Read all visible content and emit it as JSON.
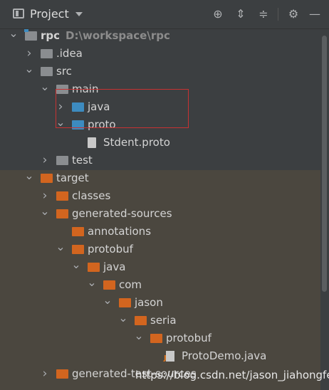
{
  "header": {
    "title": "Project",
    "icons": [
      "locate-icon",
      "expand-all-icon",
      "collapse-all-icon",
      "settings-icon",
      "hide-icon"
    ]
  },
  "tree": [
    {
      "label": "rpc",
      "path": "D:\\workspace\\rpc",
      "depth": 0,
      "arrow": "down",
      "icon": "folder-module",
      "bold": true
    },
    {
      "label": ".idea",
      "depth": 1,
      "arrow": "right",
      "icon": "folder-grey"
    },
    {
      "label": "src",
      "depth": 1,
      "arrow": "down",
      "icon": "folder-grey"
    },
    {
      "label": "main",
      "depth": 2,
      "arrow": "down",
      "icon": "folder-grey"
    },
    {
      "label": "java",
      "depth": 3,
      "arrow": "right",
      "icon": "folder-blue"
    },
    {
      "label": "proto",
      "depth": 3,
      "arrow": "down",
      "icon": "folder-blue"
    },
    {
      "label": "Stdent.proto",
      "depth": 4,
      "arrow": "none",
      "icon": "file"
    },
    {
      "label": "test",
      "depth": 2,
      "arrow": "right",
      "icon": "folder-grey"
    },
    {
      "label": "target",
      "depth": 1,
      "arrow": "down",
      "icon": "folder-orange"
    },
    {
      "label": "classes",
      "depth": 2,
      "arrow": "right",
      "icon": "folder-orange"
    },
    {
      "label": "generated-sources",
      "depth": 2,
      "arrow": "down",
      "icon": "folder-orange"
    },
    {
      "label": "annotations",
      "depth": 3,
      "arrow": "none",
      "icon": "folder-orange"
    },
    {
      "label": "protobuf",
      "depth": 3,
      "arrow": "down",
      "icon": "folder-orange"
    },
    {
      "label": "java",
      "depth": 4,
      "arrow": "down",
      "icon": "folder-orange"
    },
    {
      "label": "com",
      "depth": 5,
      "arrow": "down",
      "icon": "folder-orange"
    },
    {
      "label": "jason",
      "depth": 6,
      "arrow": "down",
      "icon": "folder-orange"
    },
    {
      "label": "seria",
      "depth": 7,
      "arrow": "down",
      "icon": "folder-orange"
    },
    {
      "label": "protobuf",
      "depth": 8,
      "arrow": "down",
      "icon": "folder-orange"
    },
    {
      "label": "ProtoDemo.java",
      "depth": 9,
      "arrow": "none",
      "icon": "java-file"
    },
    {
      "label": "generated-test-sources",
      "depth": 2,
      "arrow": "right",
      "icon": "folder-orange"
    }
  ],
  "watermark": "https://blog.csdn.net/jason_jiahongfei"
}
